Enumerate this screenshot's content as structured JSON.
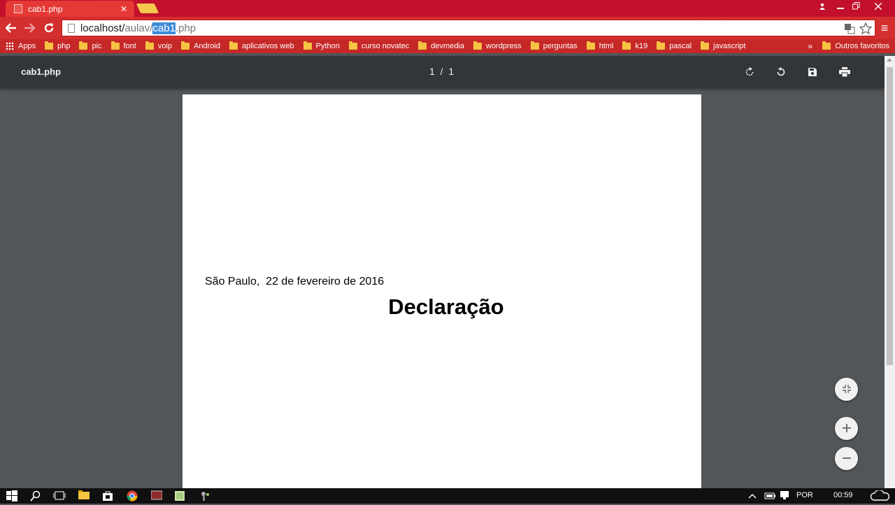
{
  "browser": {
    "tab_title": "cab1.php",
    "tab_close": "✕",
    "url_host": "localhost/",
    "url_path": "aulav/",
    "url_selected": "cab1",
    "url_ext": ".php",
    "menu_glyph": "≡"
  },
  "bookmarks": {
    "apps_label": "Apps",
    "items": [
      "php",
      "pic",
      "font",
      "voip",
      "Android",
      "aplicativos web",
      "Python",
      "curso novatec",
      "devmedia",
      "wordpress",
      "perguntas",
      "html",
      "k19",
      "pascal",
      "javascript"
    ],
    "more": "»",
    "other": "Outros favoritos"
  },
  "pdf_viewer": {
    "doc_title": "cab1.php",
    "current_page": "1",
    "page_sep": "/",
    "total_pages": "1"
  },
  "document": {
    "date_line": "São Paulo,  22 de fevereiro de 2016",
    "heading": "Declaração"
  },
  "taskbar": {
    "lang": "POR",
    "time": "00:59"
  },
  "colors": {
    "chrome_red": "#d32f2f",
    "pdf_toolbar": "#323639",
    "viewer_bg": "#525659"
  }
}
